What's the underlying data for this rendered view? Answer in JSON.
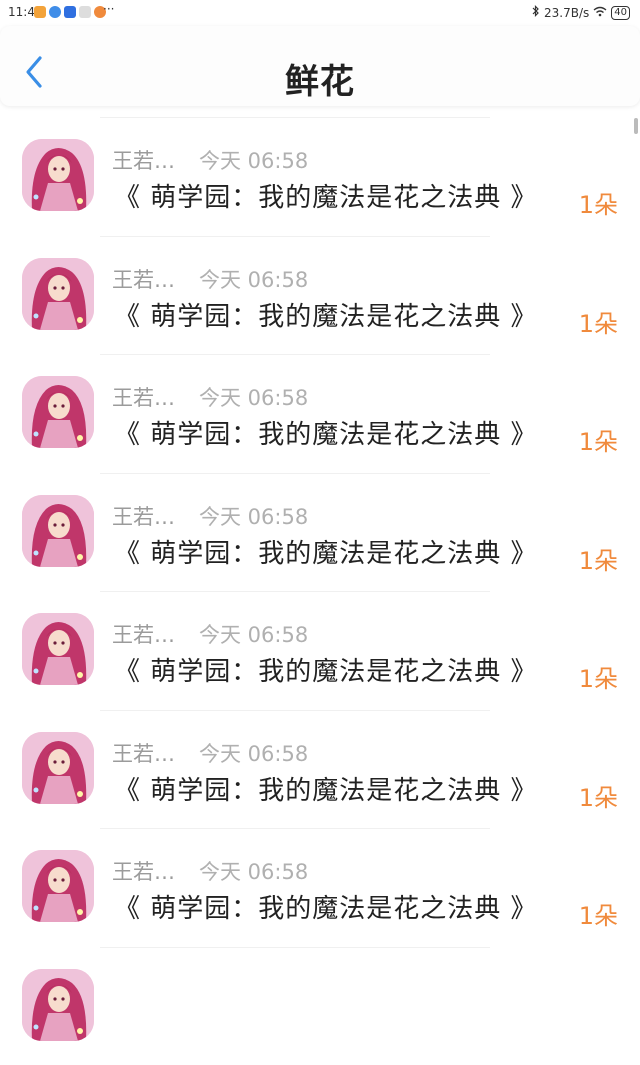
{
  "status_bar": {
    "time": "11:46",
    "network_speed": "23.7B/s",
    "battery": "40",
    "more": "···"
  },
  "header": {
    "title": "鲜花"
  },
  "colors": {
    "accent": "#3a8ee6",
    "count": "#f08a3c",
    "meta": "#9b9b9b"
  },
  "items": [
    {
      "sender": "王若…",
      "time": "今天 06:58",
      "gift": "《 萌学园：我的魔法是花之法典 》",
      "count": "1朵"
    },
    {
      "sender": "王若…",
      "time": "今天 06:58",
      "gift": "《 萌学园：我的魔法是花之法典 》",
      "count": "1朵"
    },
    {
      "sender": "王若…",
      "time": "今天 06:58",
      "gift": "《 萌学园：我的魔法是花之法典 》",
      "count": "1朵"
    },
    {
      "sender": "王若…",
      "time": "今天 06:58",
      "gift": "《 萌学园：我的魔法是花之法典 》",
      "count": "1朵"
    },
    {
      "sender": "王若…",
      "time": "今天 06:58",
      "gift": "《 萌学园：我的魔法是花之法典 》",
      "count": "1朵"
    },
    {
      "sender": "王若…",
      "time": "今天 06:58",
      "gift": "《 萌学园：我的魔法是花之法典 》",
      "count": "1朵"
    },
    {
      "sender": "王若…",
      "time": "今天 06:58",
      "gift": "《 萌学园：我的魔法是花之法典 》",
      "count": "1朵"
    },
    {
      "sender": "",
      "time": "",
      "gift": "",
      "count": ""
    }
  ]
}
